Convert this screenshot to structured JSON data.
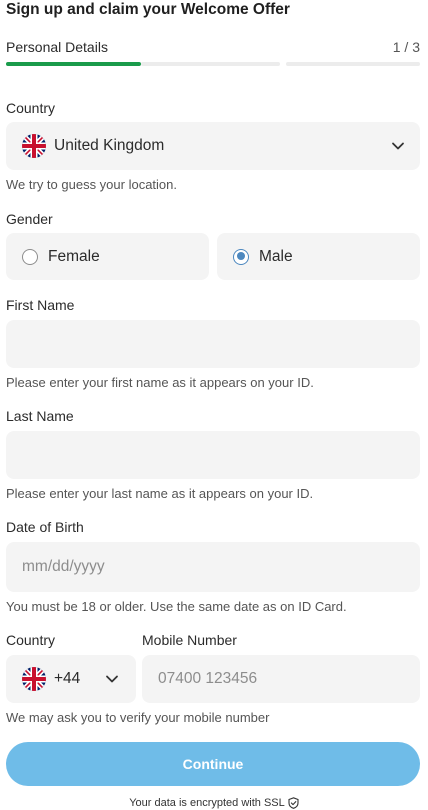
{
  "header": {
    "title": "Sign up and claim your Welcome Offer",
    "step_label": "Personal Details",
    "step_count": "1 / 3"
  },
  "progress": {
    "current_step": 1,
    "total_steps": 3
  },
  "country": {
    "label": "Country",
    "value": "United Kingdom",
    "flag_icon": "uk-flag-icon",
    "hint": "We try to guess your location."
  },
  "gender": {
    "label": "Gender",
    "options": [
      {
        "label": "Female",
        "checked": false
      },
      {
        "label": "Male",
        "checked": true
      }
    ]
  },
  "first_name": {
    "label": "First Name",
    "value": "",
    "hint": "Please enter your first name as it appears on your ID."
  },
  "last_name": {
    "label": "Last Name",
    "value": "",
    "hint": "Please enter your last name as it appears on your ID."
  },
  "dob": {
    "label": "Date of Birth",
    "placeholder": "mm/dd/yyyy",
    "hint": "You must be 18 or older. Use the same date as on ID Card."
  },
  "phone": {
    "country_label": "Country",
    "number_label": "Mobile Number",
    "dial_code": "+44",
    "placeholder": "07400 123456",
    "hint": "We may ask you to verify your mobile number"
  },
  "continue_label": "Continue",
  "ssl_note": "Your data is encrypted with SSL",
  "colors": {
    "progress_done": "#1a9b4b",
    "progress_track": "#ececec",
    "button": "#6fbce8",
    "radio_checked": "#4d88bf",
    "field_bg": "#f4f4f4"
  }
}
